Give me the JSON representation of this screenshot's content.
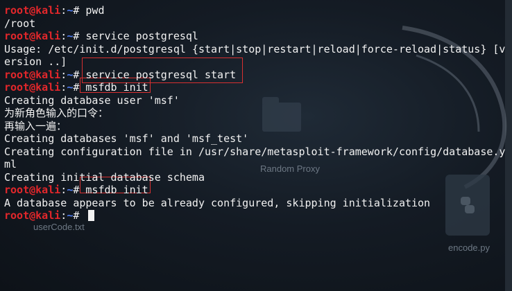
{
  "desktop": {
    "items": [
      {
        "label": "Random Proxy"
      },
      {
        "label": "userCode.txt"
      },
      {
        "label": "encode.py"
      }
    ]
  },
  "terminal": {
    "prompt_user": "root@kali",
    "prompt_sep": ":",
    "prompt_path": "~",
    "prompt_symbol": "# ",
    "lines": [
      {
        "type": "cmd",
        "text": "pwd"
      },
      {
        "type": "out",
        "text": "/root"
      },
      {
        "type": "cmd",
        "text": "service postgresql"
      },
      {
        "type": "out",
        "text": "Usage: /etc/init.d/postgresql {start|stop|restart|reload|force-reload|status} [v"
      },
      {
        "type": "out",
        "text": "ersion ..]"
      },
      {
        "type": "cmd",
        "text": "service postgresql start"
      },
      {
        "type": "cmd",
        "text": "msfdb init"
      },
      {
        "type": "out",
        "text": "Creating database user 'msf'"
      },
      {
        "type": "out",
        "text": "为新角色输入的口令："
      },
      {
        "type": "out",
        "text": "再输入一遍："
      },
      {
        "type": "out",
        "text": "Creating databases 'msf' and 'msf_test'"
      },
      {
        "type": "out",
        "text": "Creating configuration file in /usr/share/metasploit-framework/config/database.y"
      },
      {
        "type": "out",
        "text": "ml"
      },
      {
        "type": "out",
        "text": "Creating initial database schema"
      },
      {
        "type": "cmd",
        "text": "msfdb init"
      },
      {
        "type": "out",
        "text": "A database appears to be already configured, skipping initialization"
      },
      {
        "type": "cmd",
        "text": ""
      }
    ]
  }
}
